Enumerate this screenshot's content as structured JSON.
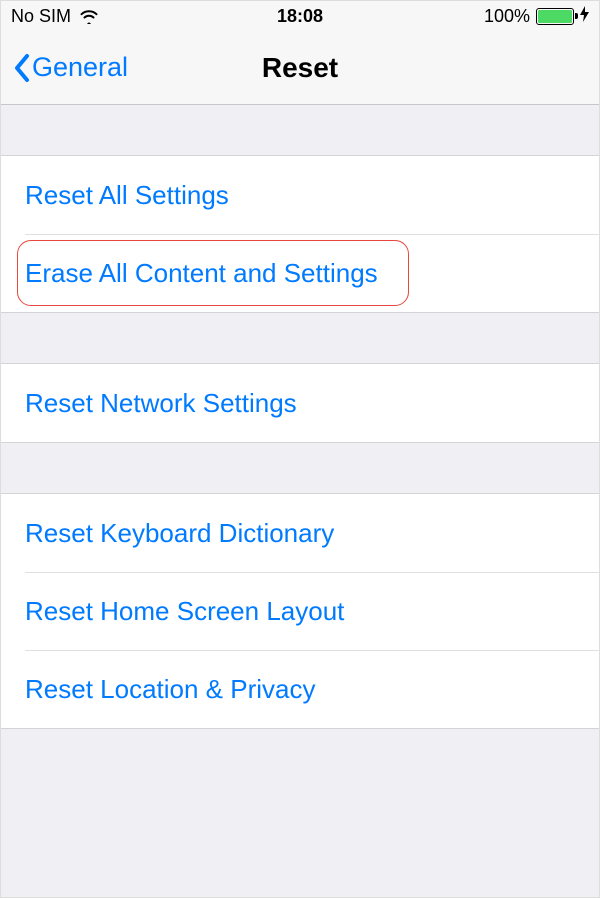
{
  "status": {
    "carrier": "No SIM",
    "time": "18:08",
    "battery_pct": "100%"
  },
  "nav": {
    "back_label": "General",
    "title": "Reset"
  },
  "groups": [
    {
      "rows": [
        {
          "label": "Reset All Settings",
          "highlighted": false
        },
        {
          "label": "Erase All Content and Settings",
          "highlighted": true
        }
      ]
    },
    {
      "rows": [
        {
          "label": "Reset Network Settings",
          "highlighted": false
        }
      ]
    },
    {
      "rows": [
        {
          "label": "Reset Keyboard Dictionary",
          "highlighted": false
        },
        {
          "label": "Reset Home Screen Layout",
          "highlighted": false
        },
        {
          "label": "Reset Location & Privacy",
          "highlighted": false
        }
      ]
    }
  ]
}
